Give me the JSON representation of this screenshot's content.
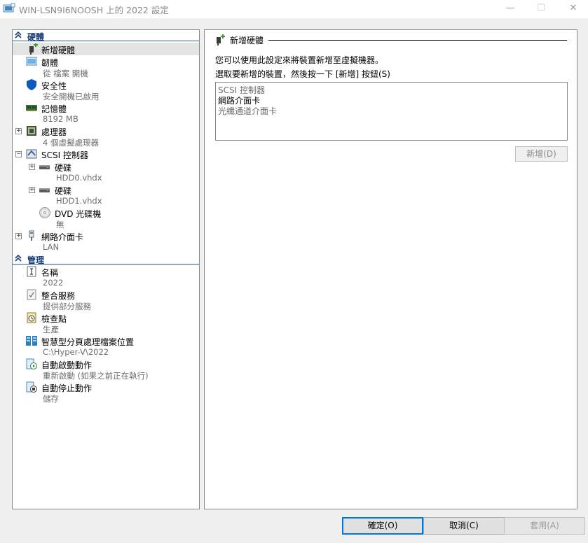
{
  "window": {
    "title": "WIN-LSN9I6NOOSH 上的 2022 設定",
    "minimize_glyph": "—",
    "maximize_glyph": "☐",
    "close_glyph": "✕"
  },
  "tree": {
    "hardware_section": "硬體",
    "management_section": "管理",
    "items": [
      {
        "label": "新增硬體",
        "sub": "",
        "icon": "add-hardware-icon"
      },
      {
        "label": "韌體",
        "sub": "從 檔案 開機",
        "icon": "firmware-icon"
      },
      {
        "label": "安全性",
        "sub": "安全開機已啟用",
        "icon": "shield-icon"
      },
      {
        "label": "記憶體",
        "sub": "8192 MB",
        "icon": "memory-icon"
      },
      {
        "label": "處理器",
        "sub": "4 個虛擬處理器",
        "icon": "processor-icon"
      },
      {
        "label": "SCSI 控制器",
        "sub": "",
        "icon": "scsi-controller-icon"
      },
      {
        "label": "硬碟",
        "sub": "HDD0.vhdx",
        "icon": "hard-drive-icon"
      },
      {
        "label": "硬碟",
        "sub": "HDD1.vhdx",
        "icon": "hard-drive-icon"
      },
      {
        "label": "DVD 光碟機",
        "sub": "無",
        "icon": "dvd-drive-icon"
      },
      {
        "label": "網路介面卡",
        "sub": "LAN",
        "icon": "network-adapter-icon"
      },
      {
        "label": "名稱",
        "sub": "2022",
        "icon": "name-icon"
      },
      {
        "label": "整合服務",
        "sub": "提供部分服務",
        "icon": "integration-services-icon"
      },
      {
        "label": "檢查點",
        "sub": "生產",
        "icon": "checkpoint-icon"
      },
      {
        "label": "智慧型分頁處理檔案位置",
        "sub": "C:\\Hyper-V\\2022",
        "icon": "smart-paging-icon"
      },
      {
        "label": "自動啟動動作",
        "sub": "重新啟動 (如果之前正在執行)",
        "icon": "auto-start-icon"
      },
      {
        "label": "自動停止動作",
        "sub": "儲存",
        "icon": "auto-stop-icon"
      }
    ]
  },
  "right": {
    "header": "新增硬體",
    "desc1": "您可以使用此設定來將裝置新增至虛擬機器。",
    "desc2": "選取要新增的裝置，然後按一下 [新增] 按鈕(S)",
    "devices": [
      "SCSI 控制器",
      "網路介面卡",
      "光纖通道介面卡"
    ],
    "selected_device": "網路介面卡",
    "add_button": "新增(D)"
  },
  "buttons": {
    "ok": "確定(O)",
    "cancel": "取消(C)",
    "apply": "套用(A)"
  },
  "colors": {
    "accent": "#0078d7",
    "section_text": "#1a3e78",
    "disabled_text": "#8a8a8a"
  }
}
